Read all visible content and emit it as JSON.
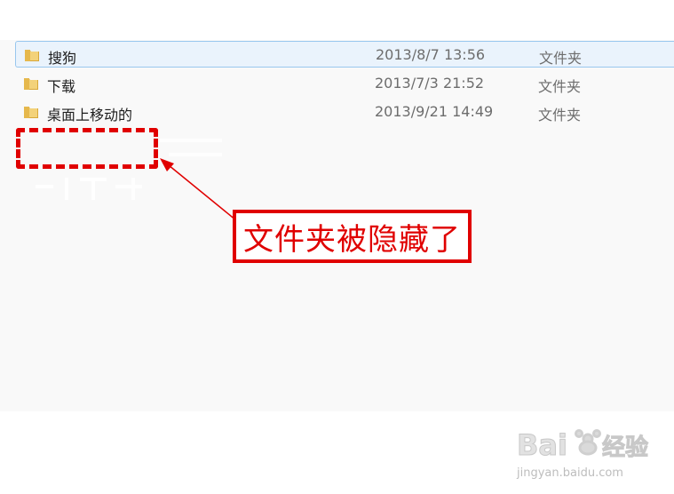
{
  "files": [
    {
      "name": "搜狗",
      "date": "2013/8/7 13:56",
      "type": "文件夹"
    },
    {
      "name": "下载",
      "date": "2013/7/3 21:52",
      "type": "文件夹"
    },
    {
      "name": "桌面上移动的",
      "date": "2013/9/21 14:49",
      "type": "文件夹"
    }
  ],
  "icons": {
    "folder": "folder-icon"
  },
  "annotation": {
    "text": "文件夹被隐藏了",
    "color": "#e00000"
  },
  "watermark": {
    "logo_text": "Baidu经验",
    "url": "jingyan.baidu.com"
  }
}
